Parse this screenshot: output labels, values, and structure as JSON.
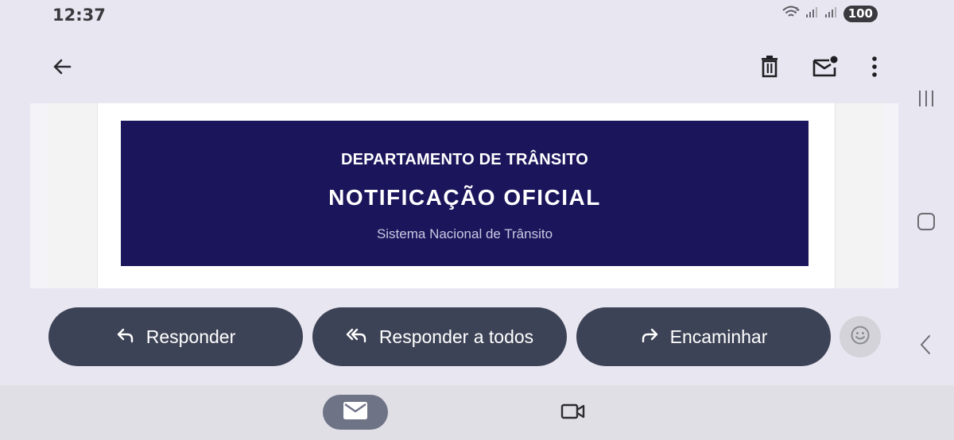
{
  "status_bar": {
    "time": "12:37",
    "battery": "100"
  },
  "email": {
    "banner": {
      "department": "DEPARTAMENTO DE TRÂNSITO",
      "title": "NOTIFICAÇÃO OFICIAL",
      "subtitle": "Sistema Nacional de Trânsito",
      "background_color": "#1b165c"
    }
  },
  "actions": {
    "reply_label": "Responder",
    "reply_all_label": "Responder a todos",
    "forward_label": "Encaminhar"
  },
  "icons": {
    "back": "arrow-left",
    "delete": "trash",
    "mark_unread": "mail-dot",
    "more": "dots-vertical",
    "emoji": "smiley",
    "mail_tab": "mail",
    "meet_tab": "video"
  },
  "colors": {
    "button_bg": "#3d4356",
    "app_bg": "#e8e6f0",
    "active_tab": "#6f7386"
  }
}
